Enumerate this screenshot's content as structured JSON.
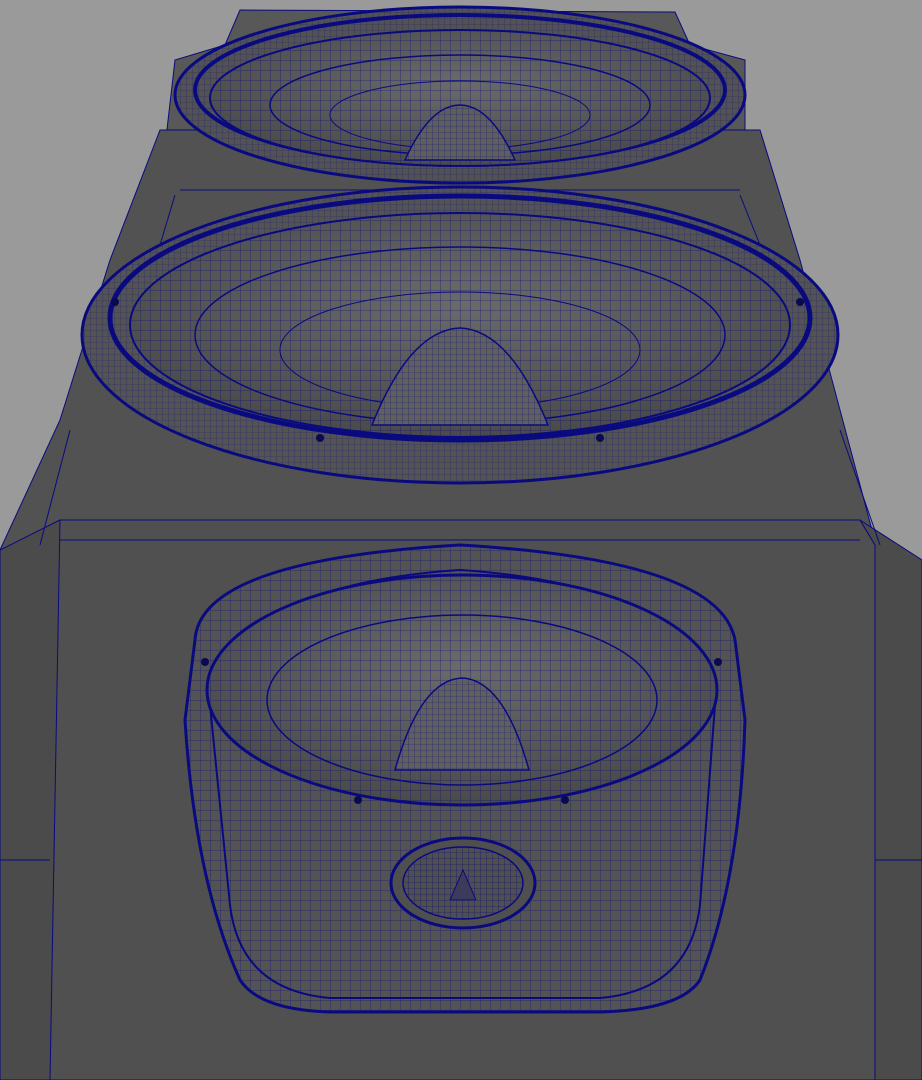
{
  "viewport": {
    "background_color": "#9a9a9a",
    "mesh_fill_color": "#555555",
    "wire_color": "#0a0a80",
    "display_mode": "wireframe-on-shaded"
  },
  "scene": {
    "object": "speaker-cabinet",
    "drivers": [
      {
        "name": "upper-driver",
        "kind": "woofer"
      },
      {
        "name": "middle-driver",
        "kind": "woofer"
      },
      {
        "name": "lower-driver",
        "kind": "woofer",
        "has_badge": true
      }
    ]
  }
}
